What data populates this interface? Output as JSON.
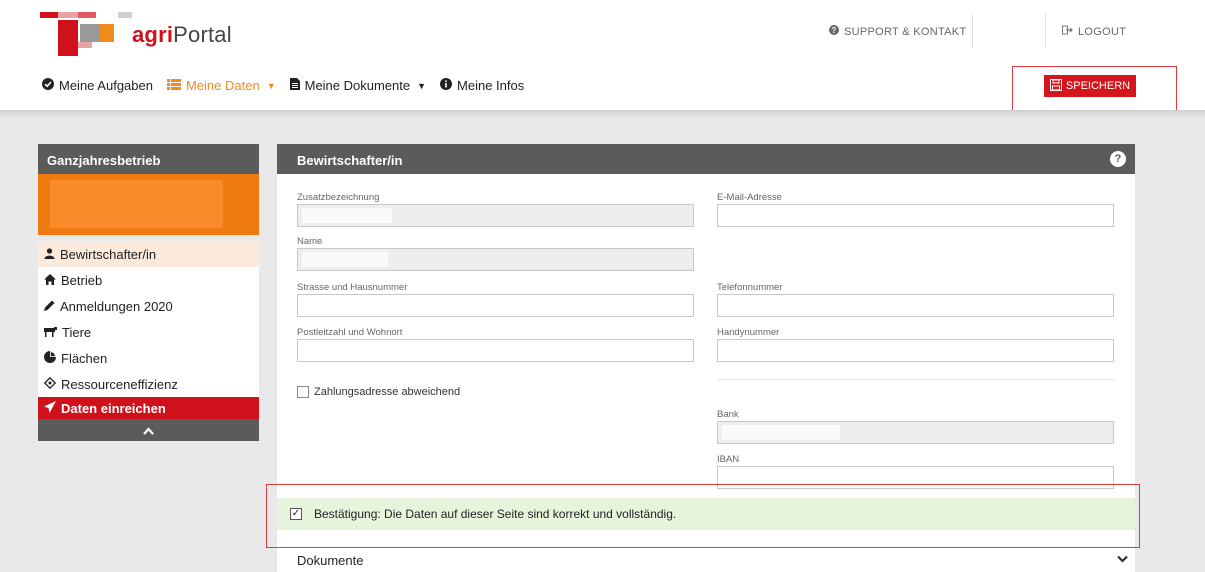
{
  "header": {
    "logo_prefix": "agri",
    "logo_suffix": "Portal",
    "support_label": "SUPPORT & KONTAKT",
    "logout_label": "LOGOUT"
  },
  "nav": {
    "items": [
      {
        "label": "Meine Aufgaben",
        "icon": "check-circle-icon"
      },
      {
        "label": "Meine Daten",
        "icon": "list-icon",
        "active": true
      },
      {
        "label": "Meine Dokumente",
        "icon": "document-icon"
      },
      {
        "label": "Meine Infos",
        "icon": "info-icon"
      }
    ],
    "save_label": "SPEICHERN"
  },
  "sidebar": {
    "title": "Ganzjahresbetrieb",
    "items": [
      {
        "label": "Bewirtschafter/in",
        "icon": "user-icon"
      },
      {
        "label": "Betrieb",
        "icon": "home-icon"
      },
      {
        "label": "Anmeldungen 2020",
        "icon": "pencil-icon"
      },
      {
        "label": "Tiere",
        "icon": "cow-icon"
      },
      {
        "label": "Flächen",
        "icon": "pie-chart-icon"
      },
      {
        "label": "Ressourceneffizienz",
        "icon": "crosshair-icon"
      },
      {
        "label": "Daten einreichen",
        "icon": "send-icon"
      }
    ]
  },
  "form": {
    "title": "Bewirtschafter/in",
    "fields": {
      "zusatz": {
        "label": "Zusatzbezeichnung",
        "value": ""
      },
      "email": {
        "label": "E-Mail-Adresse",
        "value": ""
      },
      "name": {
        "label": "Name",
        "value": ""
      },
      "strasse": {
        "label": "Strasse und Hausnummer",
        "value": ""
      },
      "telefon": {
        "label": "Telefonnummer",
        "value": ""
      },
      "plz": {
        "label": "Postleitzahl und Wohnort",
        "value": ""
      },
      "handy": {
        "label": "Handynummer",
        "value": ""
      },
      "bank": {
        "label": "Bank",
        "value": ""
      },
      "iban": {
        "label": "IBAN",
        "value": ""
      }
    },
    "payment_checkbox_label": "Zahlungsadresse abweichend",
    "confirmation_label": "Bestätigung: Die Daten auf dieser Seite sind korrekt und vollständig.",
    "documents_label": "Dokumente"
  },
  "colors": {
    "brand_red": "#d3161e",
    "accent_orange": "#f08c1e",
    "confirm_green": "#e6f4dc"
  }
}
